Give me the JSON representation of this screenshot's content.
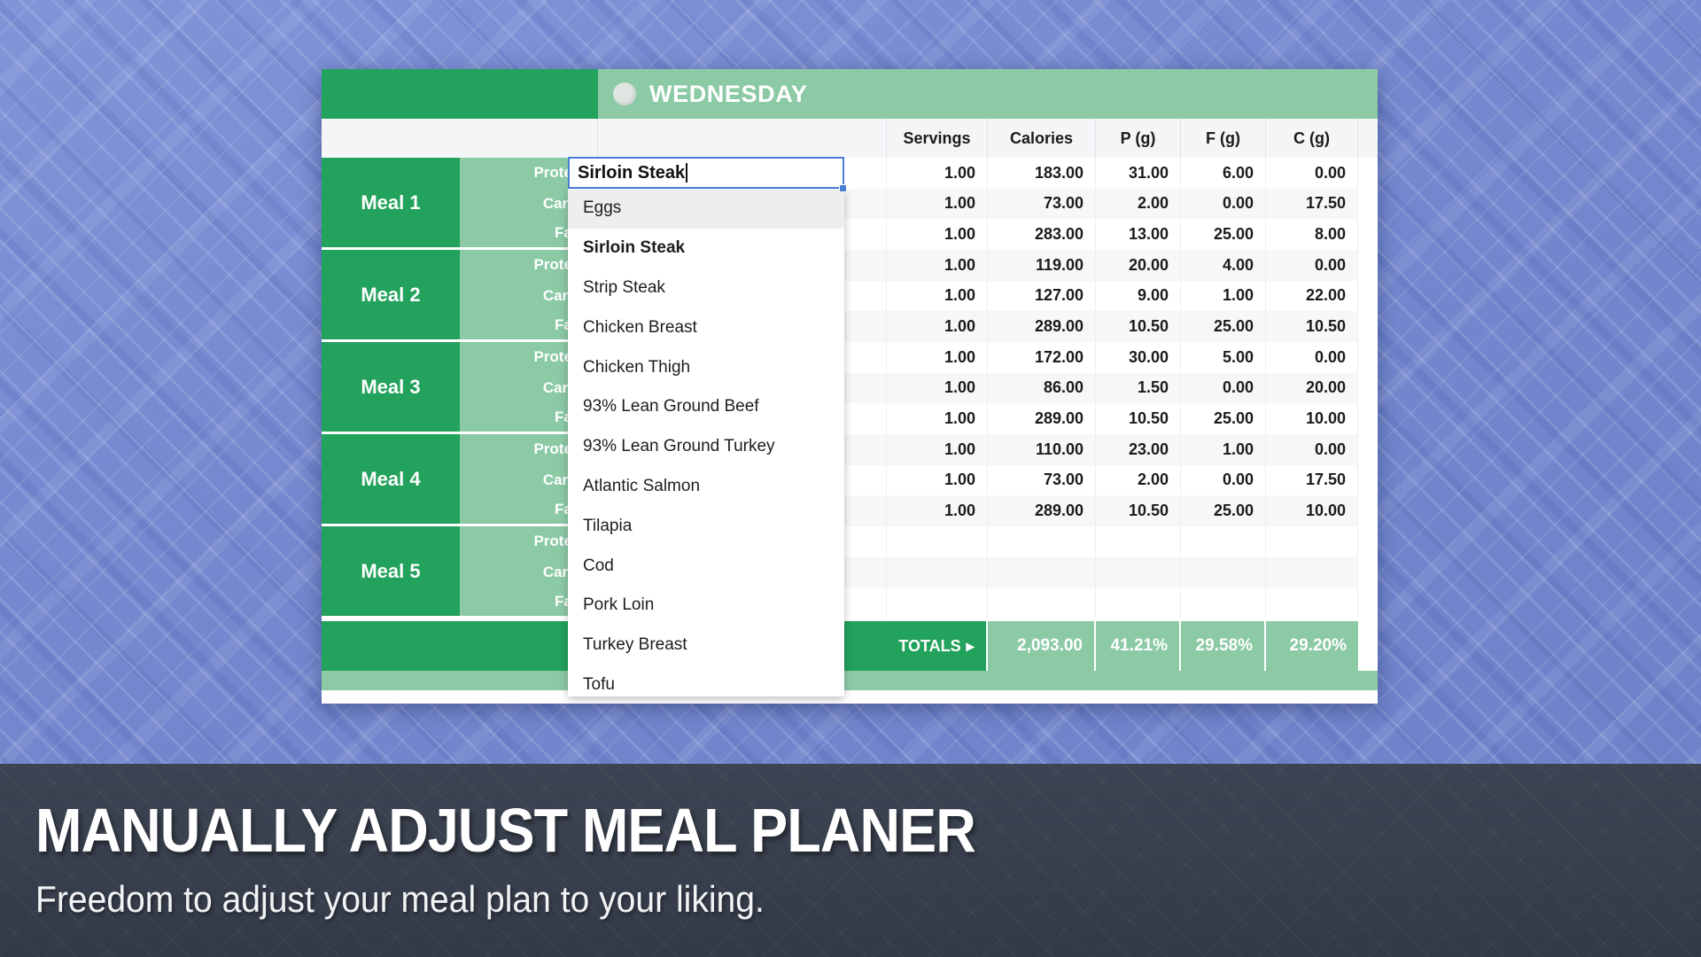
{
  "background": {
    "color": "#7488cf",
    "pattern": "diagonal-weave"
  },
  "spreadsheet": {
    "day_header": {
      "day": "WEDNESDAY",
      "dot_icon": "circle-icon",
      "accent": "#22a25c",
      "light_accent": "#8ccaa6"
    },
    "columns": [
      "Servings",
      "Calories",
      "P (g)",
      "F (g)",
      "C (g)"
    ],
    "meals": [
      "Meal 1",
      "Meal 2",
      "Meal 3",
      "Meal 4",
      "Meal 5"
    ],
    "macro_labels": [
      "Protein",
      "Carbs",
      "Fats"
    ],
    "rows": [
      {
        "food": "",
        "servings": "1.00",
        "calories": "183.00",
        "p": "31.00",
        "f": "6.00",
        "c": "0.00"
      },
      {
        "food": "",
        "servings": "1.00",
        "calories": "73.00",
        "p": "2.00",
        "f": "0.00",
        "c": "17.50"
      },
      {
        "food": "",
        "servings": "1.00",
        "calories": "283.00",
        "p": "13.00",
        "f": "25.00",
        "c": "8.00"
      },
      {
        "food": "",
        "servings": "1.00",
        "calories": "119.00",
        "p": "20.00",
        "f": "4.00",
        "c": "0.00"
      },
      {
        "food": "",
        "servings": "1.00",
        "calories": "127.00",
        "p": "9.00",
        "f": "1.00",
        "c": "22.00"
      },
      {
        "food": "",
        "servings": "1.00",
        "calories": "289.00",
        "p": "10.50",
        "f": "25.00",
        "c": "10.50"
      },
      {
        "food": "",
        "servings": "1.00",
        "calories": "172.00",
        "p": "30.00",
        "f": "5.00",
        "c": "0.00"
      },
      {
        "food": "",
        "servings": "1.00",
        "calories": "86.00",
        "p": "1.50",
        "f": "0.00",
        "c": "20.00"
      },
      {
        "food": "",
        "servings": "1.00",
        "calories": "289.00",
        "p": "10.50",
        "f": "25.00",
        "c": "10.00"
      },
      {
        "food": "",
        "servings": "1.00",
        "calories": "110.00",
        "p": "23.00",
        "f": "1.00",
        "c": "0.00"
      },
      {
        "food": "",
        "servings": "1.00",
        "calories": "73.00",
        "p": "2.00",
        "f": "0.00",
        "c": "17.50"
      },
      {
        "food": "",
        "servings": "1.00",
        "calories": "289.00",
        "p": "10.50",
        "f": "25.00",
        "c": "10.00"
      },
      {
        "food": "",
        "servings": "",
        "calories": "",
        "p": "",
        "f": "",
        "c": ""
      },
      {
        "food": "",
        "servings": "",
        "calories": "",
        "p": "",
        "f": "",
        "c": ""
      },
      {
        "food": "",
        "servings": "",
        "calories": "",
        "p": "",
        "f": "",
        "c": ""
      }
    ],
    "totals": {
      "label": "TOTALS",
      "arrow_icon": "triangle-right-icon",
      "calories": "2,093.00",
      "p_pct": "41.21%",
      "f_pct": "29.58%",
      "c_pct": "29.20%"
    }
  },
  "cell_editor": {
    "value": "Sirloin Steak",
    "border_color": "#4a7fd4"
  },
  "dropdown": {
    "items": [
      {
        "label": "Eggs",
        "highlighted": true,
        "selected": false
      },
      {
        "label": "Sirloin Steak",
        "highlighted": false,
        "selected": true
      },
      {
        "label": "Strip Steak",
        "highlighted": false,
        "selected": false
      },
      {
        "label": "Chicken Breast",
        "highlighted": false,
        "selected": false
      },
      {
        "label": "Chicken Thigh",
        "highlighted": false,
        "selected": false
      },
      {
        "label": "93% Lean Ground Beef",
        "highlighted": false,
        "selected": false
      },
      {
        "label": "93% Lean Ground Turkey",
        "highlighted": false,
        "selected": false
      },
      {
        "label": "Atlantic Salmon",
        "highlighted": false,
        "selected": false
      },
      {
        "label": "Tilapia",
        "highlighted": false,
        "selected": false
      },
      {
        "label": "Cod",
        "highlighted": false,
        "selected": false
      },
      {
        "label": "Pork Loin",
        "highlighted": false,
        "selected": false
      },
      {
        "label": "Turkey Breast",
        "highlighted": false,
        "selected": false
      },
      {
        "label": "Tofu",
        "highlighted": false,
        "selected": false
      }
    ]
  },
  "caption": {
    "title": "MANUALLY ADJUST MEAL PLANER",
    "subtitle": "Freedom to adjust your meal plan to your liking."
  }
}
